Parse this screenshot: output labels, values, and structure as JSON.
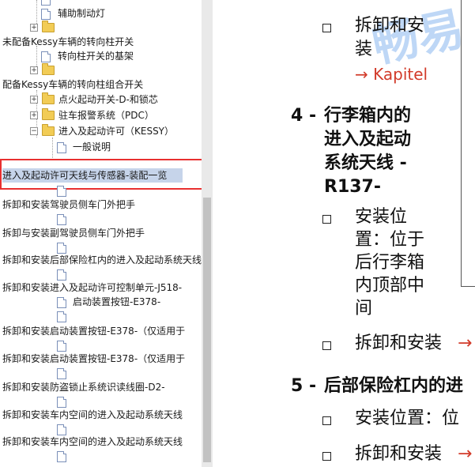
{
  "tree": {
    "items": [
      {
        "text": "辅助制动灯"
      },
      {
        "text": "未配备Kessy车辆的转向柱开关"
      },
      {
        "text": "转向柱开关的基架"
      },
      {
        "text": "配备Kessy车辆的转向柱组合开关"
      },
      {
        "text": "点火起动开关-D-和锁芯"
      },
      {
        "text": "驻车报警系统（PDC）"
      },
      {
        "text": "进入及起动许可（KESSY）"
      },
      {
        "text": "一般说明"
      },
      {
        "text": "进入及起动许可天线与传感器-装配一览"
      },
      {
        "text": "拆卸和安装驾驶员侧车门外把手"
      },
      {
        "text": "拆卸与安装副驾驶员侧车门外把手"
      },
      {
        "text": "拆卸和安装后部保险杠内的进入及起动系统天线"
      },
      {
        "text": "拆卸和安装进入及起动许可控制单元-J518-"
      },
      {
        "text": "启动装置按钮-E378-"
      },
      {
        "text": "拆卸和安装启动装置按钮-E378-（仅适用于"
      },
      {
        "text": "拆卸和安装启动装置按钮-E378-（仅适用于"
      },
      {
        "text": "拆卸和安装防盗锁止系统识读线圈-D2-"
      },
      {
        "text": "拆卸和安装车内空间的进入及起动系统天线"
      },
      {
        "text": "拆卸和安装车内空间的进入及起动系统天线"
      }
    ]
  },
  "doc": {
    "watermark": "畅易",
    "top_bullet": "拆卸和安装",
    "kapitel": "→ Kapitel",
    "sec4_num": "4 -",
    "sec4_l1": "行李箱内的",
    "sec4_l2": "进入及起动",
    "sec4_l3": "系统天线 -",
    "sec4_l4": "R137-",
    "b4a_l1": "安装位",
    "b4a_l2": "置：位于",
    "b4a_l3": "后行李箱",
    "b4a_l4": "内顶部中",
    "b4a_l5": "间",
    "b4b": "拆卸和安装",
    "arrow": "→",
    "sec5_num": "5 -",
    "sec5": "后部保险杠内的进",
    "b5a": "安装位置：位",
    "b5b": "拆卸和安装"
  }
}
